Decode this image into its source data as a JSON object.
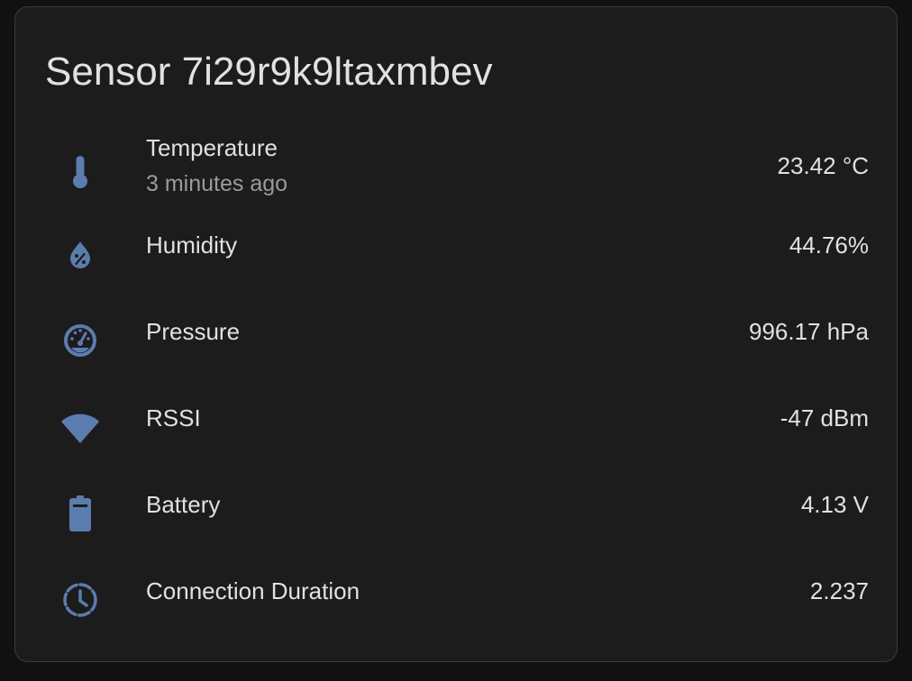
{
  "card": {
    "title": "Sensor 7i29r9k9ltaxmbev"
  },
  "colors": {
    "icon": "#5b7cae",
    "background": "#1c1c1c",
    "text": "#e1e1e1",
    "secondary_text": "#9b9b9b"
  },
  "entities": [
    {
      "name": "Temperature",
      "secondary": "3 minutes ago",
      "value": "23.42 °C",
      "icon": "thermometer-icon"
    },
    {
      "name": "Humidity",
      "value": "44.76%",
      "icon": "water-percent-icon"
    },
    {
      "name": "Pressure",
      "value": "996.17 hPa",
      "icon": "gauge-icon"
    },
    {
      "name": "RSSI",
      "value": "-47 dBm",
      "icon": "wifi-icon"
    },
    {
      "name": "Battery",
      "value": "4.13 V",
      "icon": "battery-icon"
    },
    {
      "name": "Connection Duration",
      "value": "2.237",
      "icon": "timer-outline-icon"
    }
  ]
}
